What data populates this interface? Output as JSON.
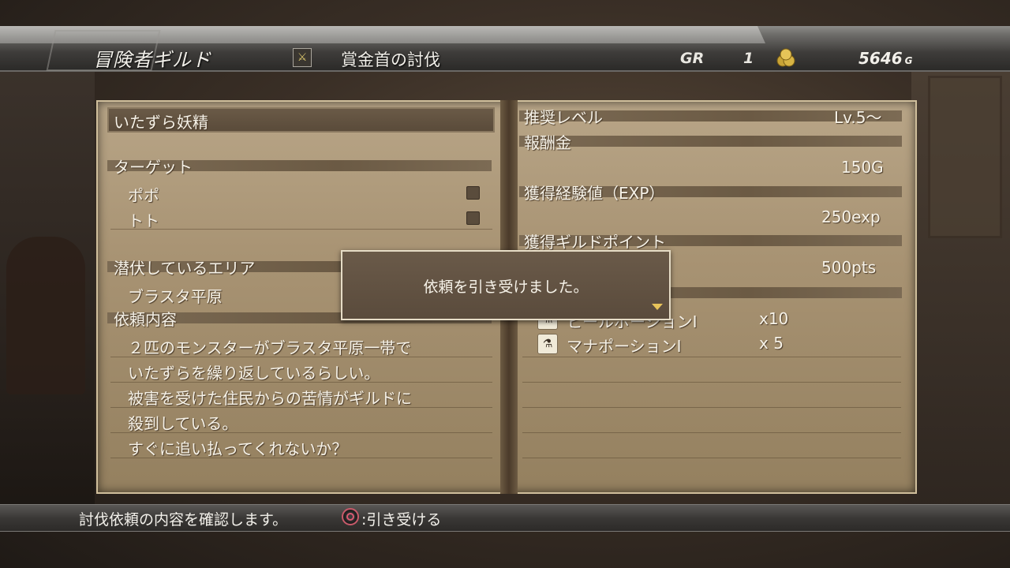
{
  "header": {
    "title": "冒険者ギルド",
    "quest_type": "賞金首の討伐",
    "gr_label": "GR",
    "gr_value": "1",
    "money": "5646",
    "money_unit": "G"
  },
  "left_page": {
    "quest_name": "いたずら妖精",
    "target_heading": "ターゲット",
    "targets": [
      "ポポ",
      "トト"
    ],
    "area_heading": "潜伏しているエリア",
    "area": "ブラスタ平原",
    "details_heading": "依頼内容",
    "details_lines": [
      "２匹のモンスターがブラスタ平原一帯で",
      "いたずらを繰り返しているらしい。",
      "被害を受けた住民からの苦情がギルドに",
      "殺到している。",
      "すぐに追い払ってくれないか？"
    ]
  },
  "right_page": {
    "level_heading": "推奨レベル",
    "level_value": "Lv.5～",
    "reward_heading": "報酬金",
    "reward_value": "150G",
    "exp_heading": "獲得経験値（EXP）",
    "exp_value": "250exp",
    "points_heading": "獲得ギルドポイント",
    "points_value": "500pts",
    "items": [
      {
        "name": "ヒールポーションⅠ",
        "qty": "x10"
      },
      {
        "name": "マナポーションⅠ",
        "qty": "x 5"
      }
    ]
  },
  "popup": {
    "message": "依頼を引き受けました。"
  },
  "footer": {
    "hint": "討伐依頼の内容を確認します。",
    "accept_label": ":引き受ける"
  }
}
